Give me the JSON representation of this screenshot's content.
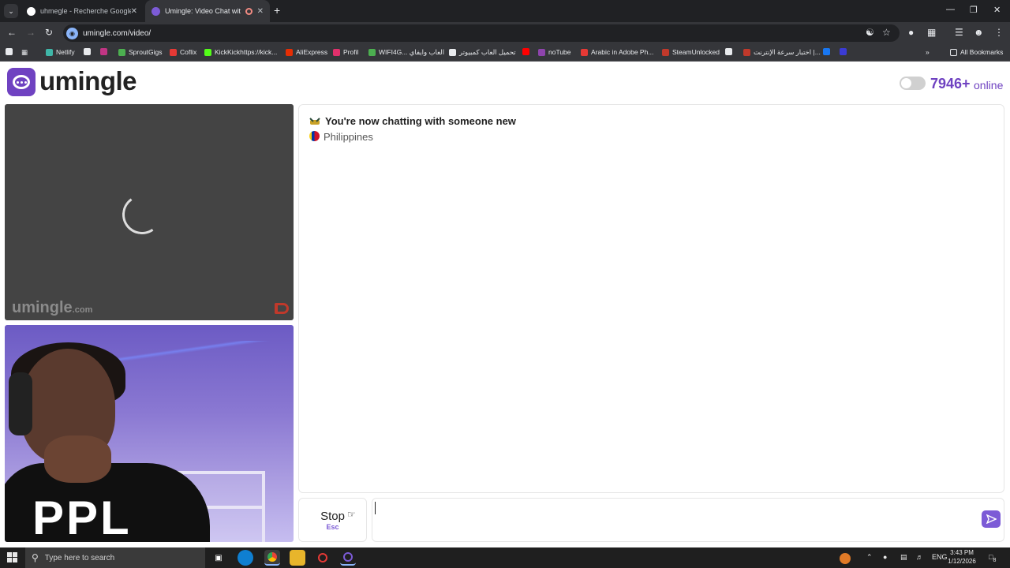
{
  "browser": {
    "tabs": [
      {
        "title": "uhmegle - Recherche Google",
        "active": false
      },
      {
        "title": "Umingle: Video Chat with Stra",
        "active": true
      }
    ],
    "url": "umingle.com/video/",
    "bookmarks": [
      {
        "label": "Netlify",
        "color": "#3fb6a8"
      },
      {
        "label": "",
        "color": "#e8eaed"
      },
      {
        "label": "",
        "color": "#c13584"
      },
      {
        "label": "SproutGigs",
        "color": "#4caf50"
      },
      {
        "label": "Coflix",
        "color": "#e53935"
      },
      {
        "label": "KickKickhttps://kick...",
        "color": "#53fc18"
      },
      {
        "label": "AliExpress",
        "color": "#e62e04"
      },
      {
        "label": "Profil",
        "color": "#e1306c"
      },
      {
        "label": "WIFI4G... العاب وايفاي",
        "color": "#4caf50"
      },
      {
        "label": "تحميل العاب كمبيوتر",
        "color": "#e8eaed"
      },
      {
        "label": "",
        "color": "#ff0000"
      },
      {
        "label": "noTube",
        "color": "#8e44ad"
      },
      {
        "label": "Arabic in Adobe Ph...",
        "color": "#e53935"
      },
      {
        "label": "SteamUnlocked",
        "color": "#c0392b"
      },
      {
        "label": "",
        "color": "#e8eaed"
      },
      {
        "label": "اختبار سرعة الإنترنت |...",
        "color": "#c0392b"
      },
      {
        "label": "",
        "color": "#1877f2"
      },
      {
        "label": "",
        "color": "#3b3bd4"
      }
    ],
    "all_bookmarks_label": "All Bookmarks"
  },
  "page": {
    "logo_text": "umingle",
    "online_count": "7946+",
    "online_label": "online",
    "watermark_main": "umingle",
    "watermark_suffix": ".com",
    "chat_message": "You're now chatting with someone new",
    "country": "Philippines",
    "stop_label": "Stop",
    "stop_shortcut": "Esc",
    "input_value": "",
    "accent_color": "#6f42c1"
  },
  "taskbar": {
    "search_placeholder": "Type here to search",
    "language": "ENG",
    "time": "3:43 PM",
    "date": "1/12/2026",
    "notifications": "8"
  }
}
